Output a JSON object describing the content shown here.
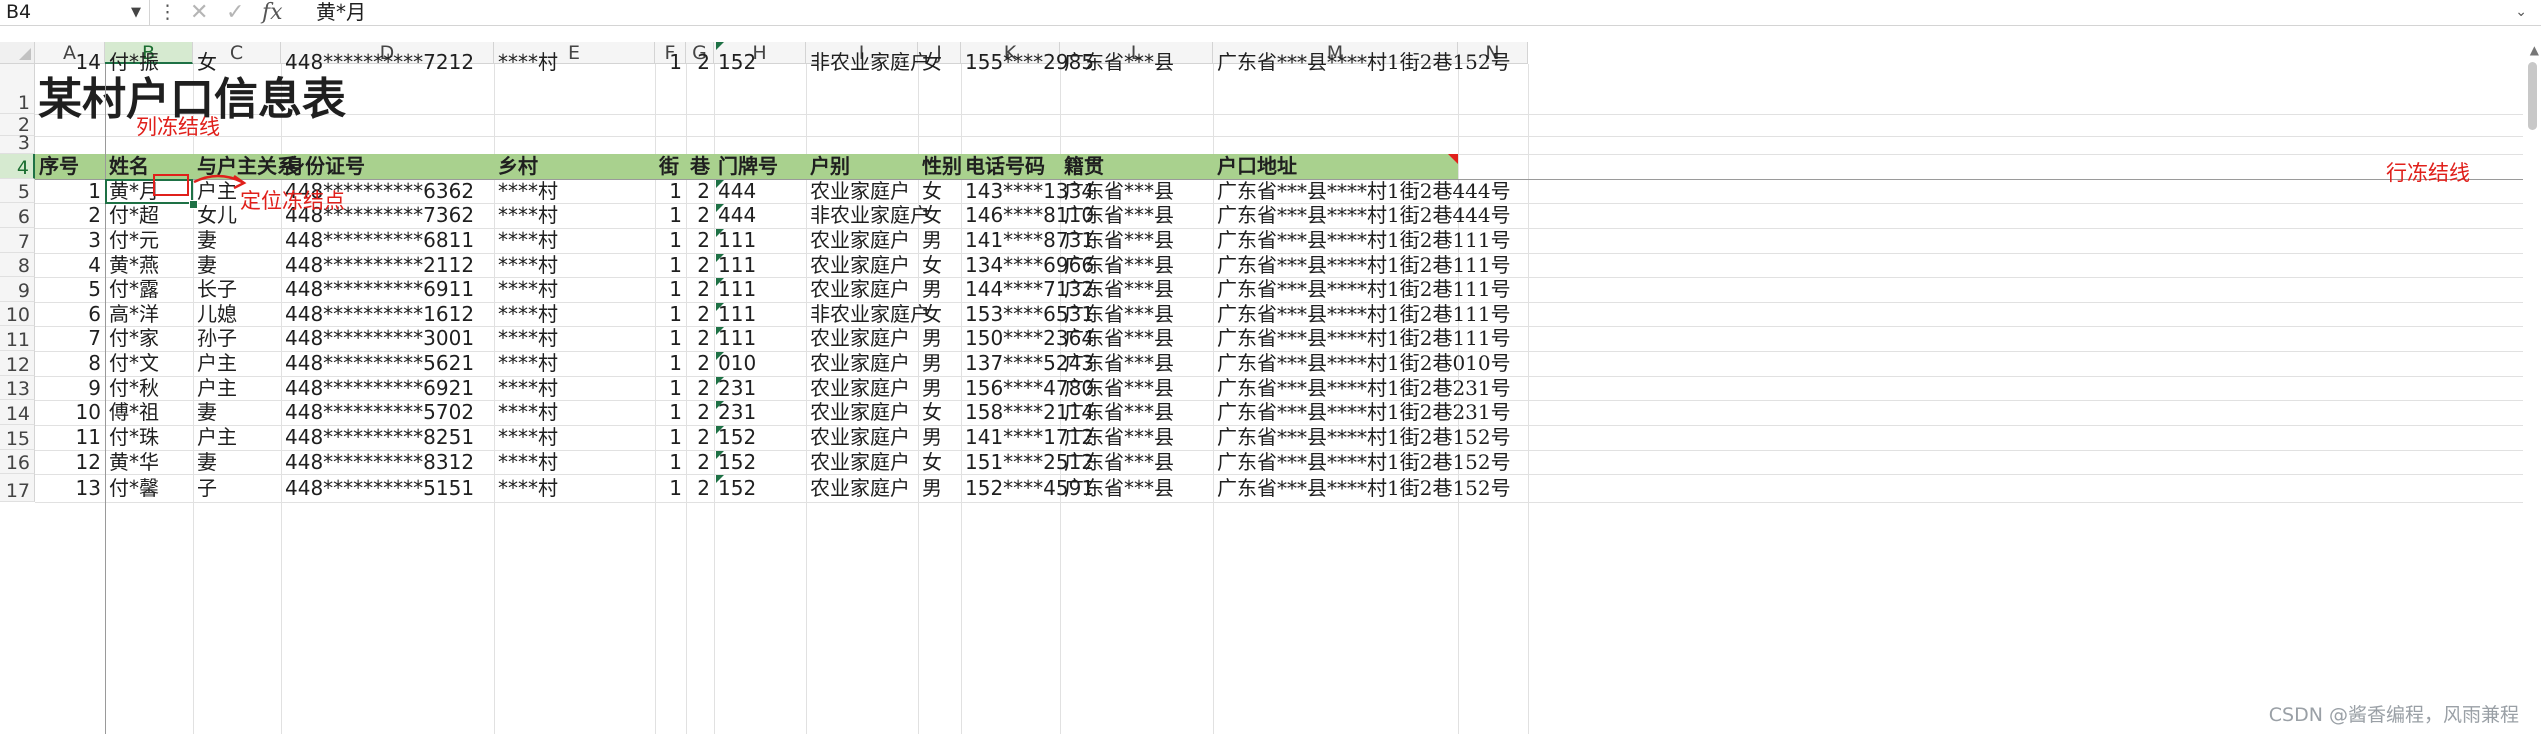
{
  "formula_bar": {
    "cell_ref": "B4",
    "more": "⋮",
    "cancel": "✕",
    "enter": "✓",
    "fx": "fx",
    "content": "黄*月",
    "expand": "⌄"
  },
  "columns": [
    "A",
    "B",
    "C",
    "D",
    "E",
    "F",
    "G",
    "H",
    "I",
    "J",
    "K",
    "L",
    "M",
    "N"
  ],
  "selected_column": "B",
  "selected_row": "4",
  "row_numbers": [
    "1",
    "2",
    "3",
    "4",
    "5",
    "6",
    "7",
    "8",
    "9",
    "10",
    "11",
    "12",
    "13",
    "14",
    "15",
    "16",
    "17"
  ],
  "title": "某村户口信息表",
  "headers": [
    "序号",
    "姓名",
    "与户主关系",
    "身份证号",
    "乡村",
    "街",
    "巷",
    "门牌号",
    "户别",
    "性别",
    "电话号码",
    "籍贯",
    "户口地址"
  ],
  "rows": [
    [
      "1",
      "黄*月",
      "户主",
      "448**********6362",
      "****村",
      "1",
      "2",
      "444",
      "农业家庭户",
      "女",
      "143****1334",
      "广东省***县",
      "广东省***县****村1街2巷444号"
    ],
    [
      "2",
      "付*超",
      "女儿",
      "448**********7362",
      "****村",
      "1",
      "2",
      "444",
      "非农业家庭户",
      "女",
      "146****8110",
      "广东省***县",
      "广东省***县****村1街2巷444号"
    ],
    [
      "3",
      "付*元",
      "妻",
      "448**********6811",
      "****村",
      "1",
      "2",
      "111",
      "农业家庭户",
      "男",
      "141****8731",
      "广东省***县",
      "广东省***县****村1街2巷111号"
    ],
    [
      "4",
      "黄*燕",
      "妻",
      "448**********2112",
      "****村",
      "1",
      "2",
      "111",
      "农业家庭户",
      "女",
      "134****6966",
      "广东省***县",
      "广东省***县****村1街2巷111号"
    ],
    [
      "5",
      "付*露",
      "长子",
      "448**********6911",
      "****村",
      "1",
      "2",
      "111",
      "农业家庭户",
      "男",
      "144****7132",
      "广东省***县",
      "广东省***县****村1街2巷111号"
    ],
    [
      "6",
      "高*洋",
      "儿媳",
      "448**********1612",
      "****村",
      "1",
      "2",
      "111",
      "非农业家庭户",
      "女",
      "153****6531",
      "广东省***县",
      "广东省***县****村1街2巷111号"
    ],
    [
      "7",
      "付*家",
      "孙子",
      "448**********3001",
      "****村",
      "1",
      "2",
      "111",
      "农业家庭户",
      "男",
      "150****2364",
      "广东省***县",
      "广东省***县****村1街2巷111号"
    ],
    [
      "8",
      "付*文",
      "户主",
      "448**********5621",
      "****村",
      "1",
      "2",
      "010",
      "农业家庭户",
      "男",
      "137****5243",
      "广东省***县",
      "广东省***县****村1街2巷010号"
    ],
    [
      "9",
      "付*秋",
      "户主",
      "448**********6921",
      "****村",
      "1",
      "2",
      "231",
      "农业家庭户",
      "男",
      "156****4780",
      "广东省***县",
      "广东省***县****村1街2巷231号"
    ],
    [
      "10",
      "傅*祖",
      "妻",
      "448**********5702",
      "****村",
      "1",
      "2",
      "231",
      "农业家庭户",
      "女",
      "158****2114",
      "广东省***县",
      "广东省***县****村1街2巷231号"
    ],
    [
      "11",
      "付*珠",
      "户主",
      "448**********8251",
      "****村",
      "1",
      "2",
      "152",
      "农业家庭户",
      "男",
      "141****1712",
      "广东省***县",
      "广东省***县****村1街2巷152号"
    ],
    [
      "12",
      "黄*华",
      "妻",
      "448**********8312",
      "****村",
      "1",
      "2",
      "152",
      "农业家庭户",
      "女",
      "151****2512",
      "广东省***县",
      "广东省***县****村1街2巷152号"
    ],
    [
      "13",
      "付*馨",
      "子",
      "448**********5151",
      "****村",
      "1",
      "2",
      "152",
      "农业家庭户",
      "男",
      "152****4591",
      "广东省***县",
      "广东省***县****村1街2巷152号"
    ],
    [
      "14",
      "付*振",
      "女",
      "448**********7212",
      "****村",
      "1",
      "2",
      "152",
      "非农业家庭户",
      "女",
      "155****2985",
      "广东省***县",
      "广东省***县****村1街2巷152号"
    ]
  ],
  "annotations": {
    "col_freeze": "列冻结线",
    "anchor": "定位冻结点",
    "row_freeze": "行冻结线"
  },
  "colors": {
    "header_fill": "#a9d18e",
    "annotation": "#e0201b",
    "selection": "#1e7145"
  },
  "watermark": "CSDN @酱香编程，风雨兼程"
}
